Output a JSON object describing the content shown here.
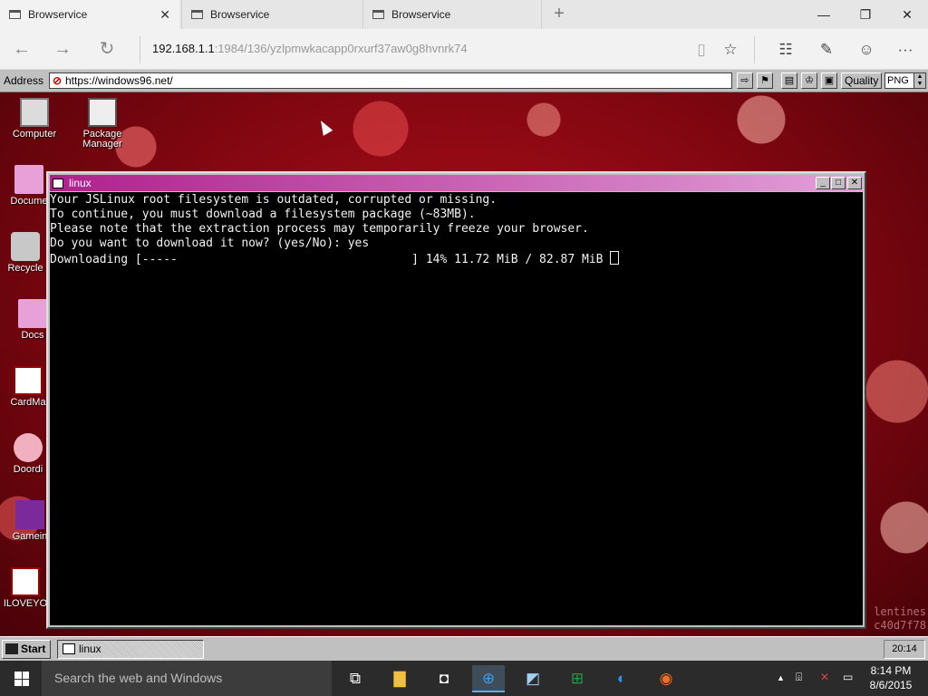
{
  "browser": {
    "tabs": [
      {
        "title": "Browservice",
        "close": "✕"
      },
      {
        "title": "Browservice"
      },
      {
        "title": "Browservice"
      }
    ],
    "new_tab": "+",
    "window_controls": {
      "minimize": "—",
      "restore": "❐",
      "close": "✕"
    },
    "nav": {
      "back": "←",
      "forward": "→",
      "refresh": "↻"
    },
    "url": {
      "host": "192.168.1.1",
      "path": ":1984/136/yzlpmwkacapp0rxurf37aw0g8hvnrk74"
    },
    "right_icons": {
      "reading": "▯",
      "favorite": "☆",
      "hub": "☷",
      "note": "✎",
      "feedback": "☺",
      "more": "···"
    }
  },
  "w96bar": {
    "address_label": "Address",
    "address_value": "https://windows96.net/",
    "buttons": {
      "go": "⇨",
      "bookmark": "⚑",
      "b1": "▤",
      "b2": "♔",
      "b3": "▣"
    },
    "quality_label": "Quality",
    "format_value": "PNG"
  },
  "desktop_icons": [
    {
      "label": "Computer"
    },
    {
      "label": "Package Manager"
    },
    {
      "label": "Docume"
    },
    {
      "label": "Recycle"
    },
    {
      "label": "Docs"
    },
    {
      "label": "CardMa"
    },
    {
      "label": "Doordi"
    },
    {
      "label": "Gamein"
    },
    {
      "label": "ILOVEYO"
    }
  ],
  "watermark": {
    "line1": "lentines",
    "line2": "c40d7f78"
  },
  "linux_window": {
    "title": "linux",
    "buttons": {
      "minimize": "_",
      "maximize": "□",
      "close": "✕"
    },
    "terminal_lines": [
      "Your JSLinux root filesystem is outdated, corrupted or missing.",
      "To continue, you must download a filesystem package (~83MB).",
      "Please note that the extraction process may temporarily freeze your browser.",
      "Do you want to download it now? (yes/No): yes",
      "Downloading [-----                                 ] 14% 11.72 MiB / 82.87 MiB "
    ],
    "download_progress_percent": 14
  },
  "w96_taskbar": {
    "start_label": "Start",
    "task_label": "linux",
    "clock": "20:14"
  },
  "win10_taskbar": {
    "search_placeholder": "Search the web and Windows",
    "apps": {
      "task_view": "⧉",
      "explorer": "▇",
      "store": "◘",
      "edge": "⊕",
      "paint": "◩",
      "excel": "⊞",
      "app6": "◐",
      "app7": "◉"
    },
    "tray": {
      "chevron": "▲",
      "network": "⌹",
      "volume": "✕",
      "action_center": "▭"
    },
    "time": "8:14 PM",
    "date": "8/6/2015"
  }
}
